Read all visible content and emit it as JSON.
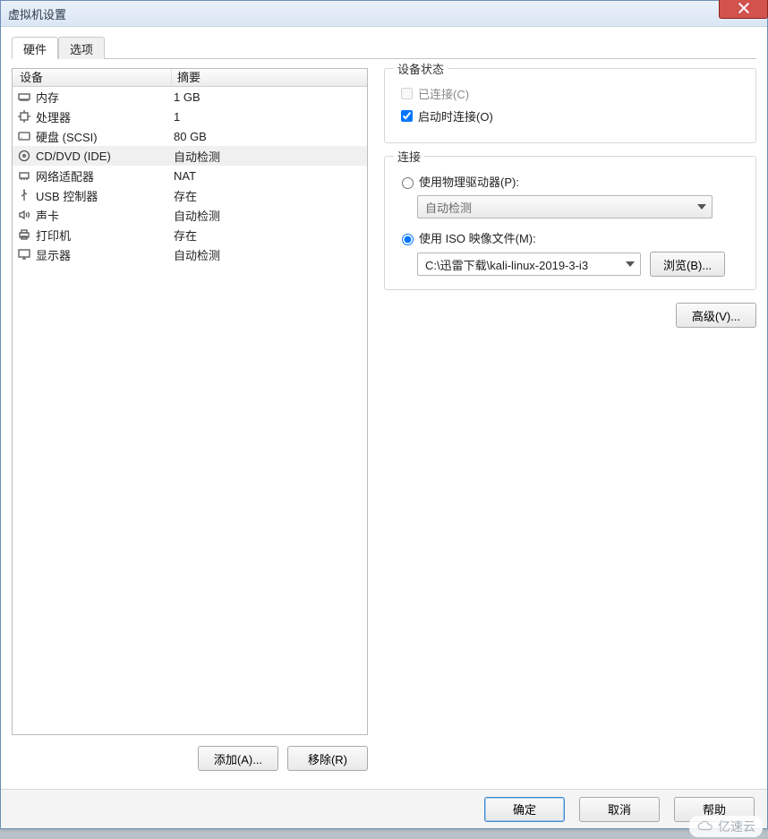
{
  "window": {
    "title": "虚拟机设置"
  },
  "tabs": {
    "hardware": "硬件",
    "options": "选项"
  },
  "hw_header": {
    "device": "设备",
    "summary": "摘要"
  },
  "hw_rows": [
    {
      "icon": "memory-icon",
      "name": "内存",
      "summary": "1 GB"
    },
    {
      "icon": "cpu-icon",
      "name": "处理器",
      "summary": "1"
    },
    {
      "icon": "hdd-icon",
      "name": "硬盘 (SCSI)",
      "summary": "80 GB"
    },
    {
      "icon": "disc-icon",
      "name": "CD/DVD (IDE)",
      "summary": "自动检测"
    },
    {
      "icon": "nic-icon",
      "name": "网络适配器",
      "summary": "NAT"
    },
    {
      "icon": "usb-icon",
      "name": "USB 控制器",
      "summary": "存在"
    },
    {
      "icon": "sound-icon",
      "name": "声卡",
      "summary": "自动检测"
    },
    {
      "icon": "printer-icon",
      "name": "打印机",
      "summary": "存在"
    },
    {
      "icon": "display-icon",
      "name": "显示器",
      "summary": "自动检测"
    }
  ],
  "hw_selected_index": 3,
  "left_buttons": {
    "add": "添加(A)...",
    "remove": "移除(R)"
  },
  "status_group": {
    "legend": "设备状态",
    "connected": "已连接(C)",
    "connect_on_start": "启动时连接(O)",
    "connected_checked": false,
    "connect_on_start_checked": true
  },
  "connect_group": {
    "legend": "连接",
    "use_physical": "使用物理驱动器(P):",
    "physical_value": "自动检测",
    "use_iso": "使用 ISO 映像文件(M):",
    "iso_value": "C:\\迅雷下载\\kali-linux-2019-3-i3",
    "browse": "浏览(B)...",
    "selected": "iso"
  },
  "advanced": "高级(V)...",
  "footer": {
    "ok": "确定",
    "cancel": "取消",
    "help": "帮助"
  },
  "watermark": "亿速云"
}
